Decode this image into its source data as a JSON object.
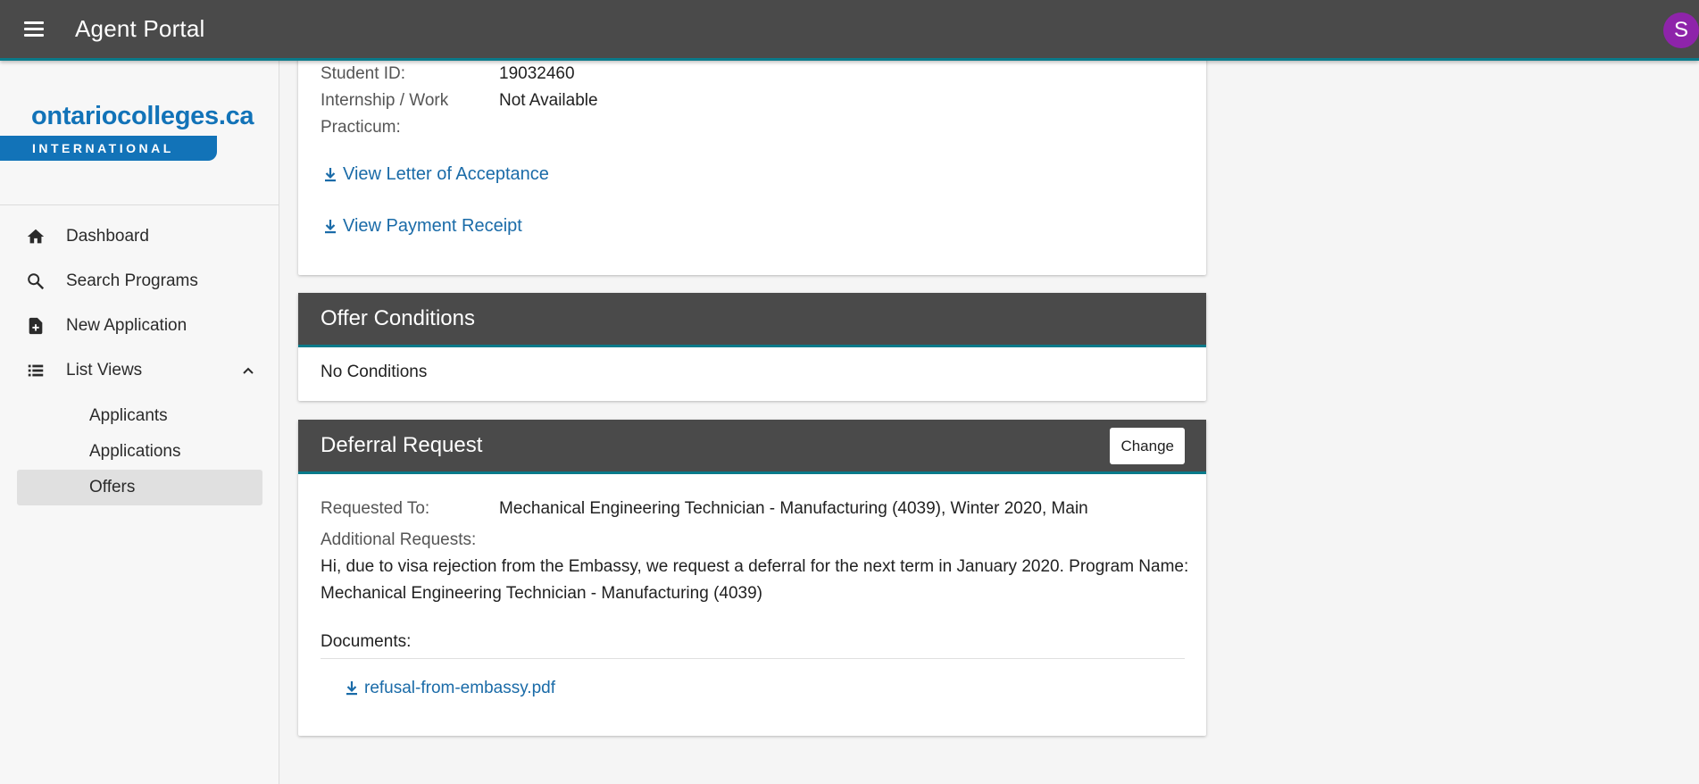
{
  "header": {
    "title": "Agent Portal",
    "avatar_initial": "S"
  },
  "logo": {
    "name": "ontariocolleges.ca",
    "tagline": "INTERNATIONAL"
  },
  "sidebar": {
    "items": [
      {
        "label": "Dashboard",
        "icon": "home-icon"
      },
      {
        "label": "Search Programs",
        "icon": "search-icon"
      },
      {
        "label": "New Application",
        "icon": "add-document-icon"
      },
      {
        "label": "List Views",
        "icon": "list-icon"
      }
    ],
    "subitems": [
      {
        "label": "Applicants"
      },
      {
        "label": "Applications"
      },
      {
        "label": "Offers",
        "active": true
      }
    ]
  },
  "offer_details": {
    "student_id_label": "Student ID:",
    "student_id_value": "19032460",
    "internship_label_1": "Internship / Work",
    "internship_label_2": "Practicum:",
    "internship_value": "Not Available",
    "letter_link": "View Letter of Acceptance",
    "receipt_link": "View Payment Receipt"
  },
  "offer_conditions": {
    "title": "Offer Conditions",
    "body": "No Conditions"
  },
  "deferral": {
    "title": "Deferral Request",
    "change_label": "Change",
    "requested_to_label": "Requested To:",
    "requested_to_value": "Mechanical Engineering Technician - Manufacturing (4039), Winter 2020, Main",
    "additional_label": "Additional Requests:",
    "additional_text": "Hi, due to visa rejection from the Embassy, we request a deferral for the next term in January 2020. Program Name: Mechanical Engineering Technician - Manufacturing (4039)",
    "documents_label": "Documents:",
    "document_name": "refusal-from-embassy.pdf"
  },
  "colors": {
    "header": "#4a4a4a",
    "accent": "#0a7a8a",
    "link": "#1a6ba8",
    "brand": "#1273b8",
    "avatar": "#8e24aa"
  }
}
